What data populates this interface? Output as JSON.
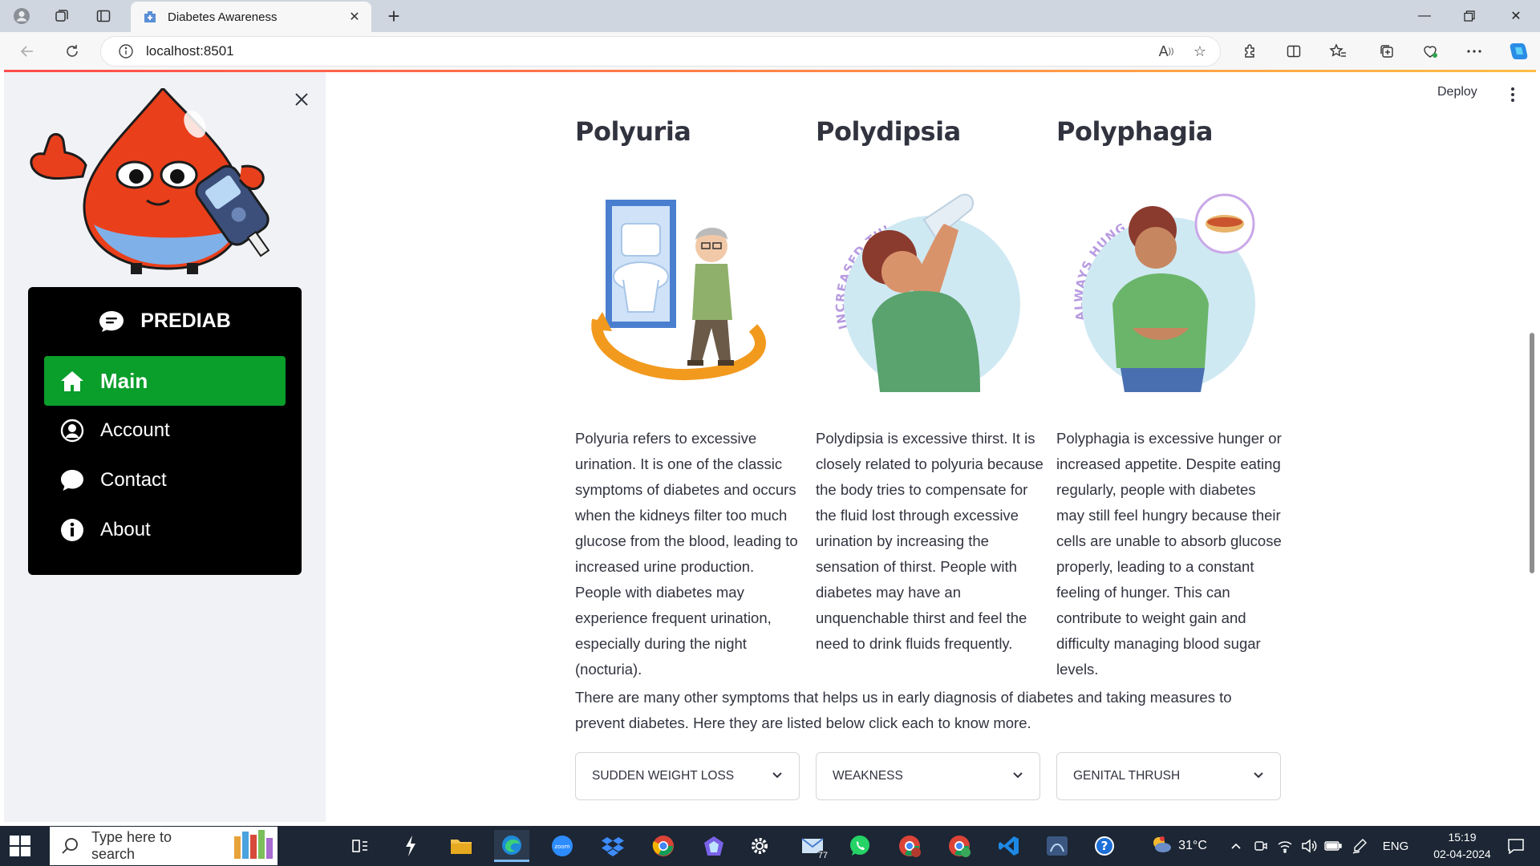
{
  "browser": {
    "tab_title": "Diabetes Awareness",
    "url": "localhost:8501"
  },
  "app": {
    "deploy_label": "Deploy"
  },
  "sidebar": {
    "menu_title": "PREDIAB",
    "items": [
      {
        "label": "Main",
        "icon": "home-icon",
        "active": true
      },
      {
        "label": "Account",
        "icon": "user-circle-icon",
        "active": false
      },
      {
        "label": "Contact",
        "icon": "chat-bubble-icon",
        "active": false
      },
      {
        "label": "About",
        "icon": "info-icon",
        "active": false
      }
    ],
    "active_color": "#0a9e2b"
  },
  "symptoms": [
    {
      "title": "Polyuria",
      "description": "Polyuria refers to excessive urination. It is one of the classic symptoms of diabetes and occurs when the kidneys filter too much glucose from the blood, leading to increased urine production. People with diabetes may experience frequent urination, especially during the night (nocturia)."
    },
    {
      "title": "Polydipsia",
      "illustration_text": "INCREASED THIRST",
      "description": "Polydipsia is excessive thirst. It is closely related to polyuria because the body tries to compensate for the fluid lost through excessive urination by increasing the sensation of thirst. People with diabetes may have an unquenchable thirst and feel the need to drink fluids frequently."
    },
    {
      "title": "Polyphagia",
      "illustration_text": "ALWAYS HUNGRY",
      "description": "Polyphagia is excessive hunger or increased appetite. Despite eating regularly, people with diabetes may still feel hungry because their cells are unable to absorb glucose properly, leading to a constant feeling of hunger. This can contribute to weight gain and difficulty managing blood sugar levels."
    }
  ],
  "intro_text": "There are many other symptoms that helps us in early diagnosis of diabetes and taking measures to prevent diabetes. Here they are listed below click each to know more.",
  "expanders": [
    {
      "label": "SUDDEN WEIGHT LOSS"
    },
    {
      "label": "WEAKNESS"
    },
    {
      "label": "GENITAL THRUSH"
    }
  ],
  "taskbar": {
    "search_placeholder": "Type here to search",
    "weather": "31°C",
    "language": "ENG",
    "time": "15:19",
    "date": "02-04-2024",
    "mail_badge": "77"
  }
}
